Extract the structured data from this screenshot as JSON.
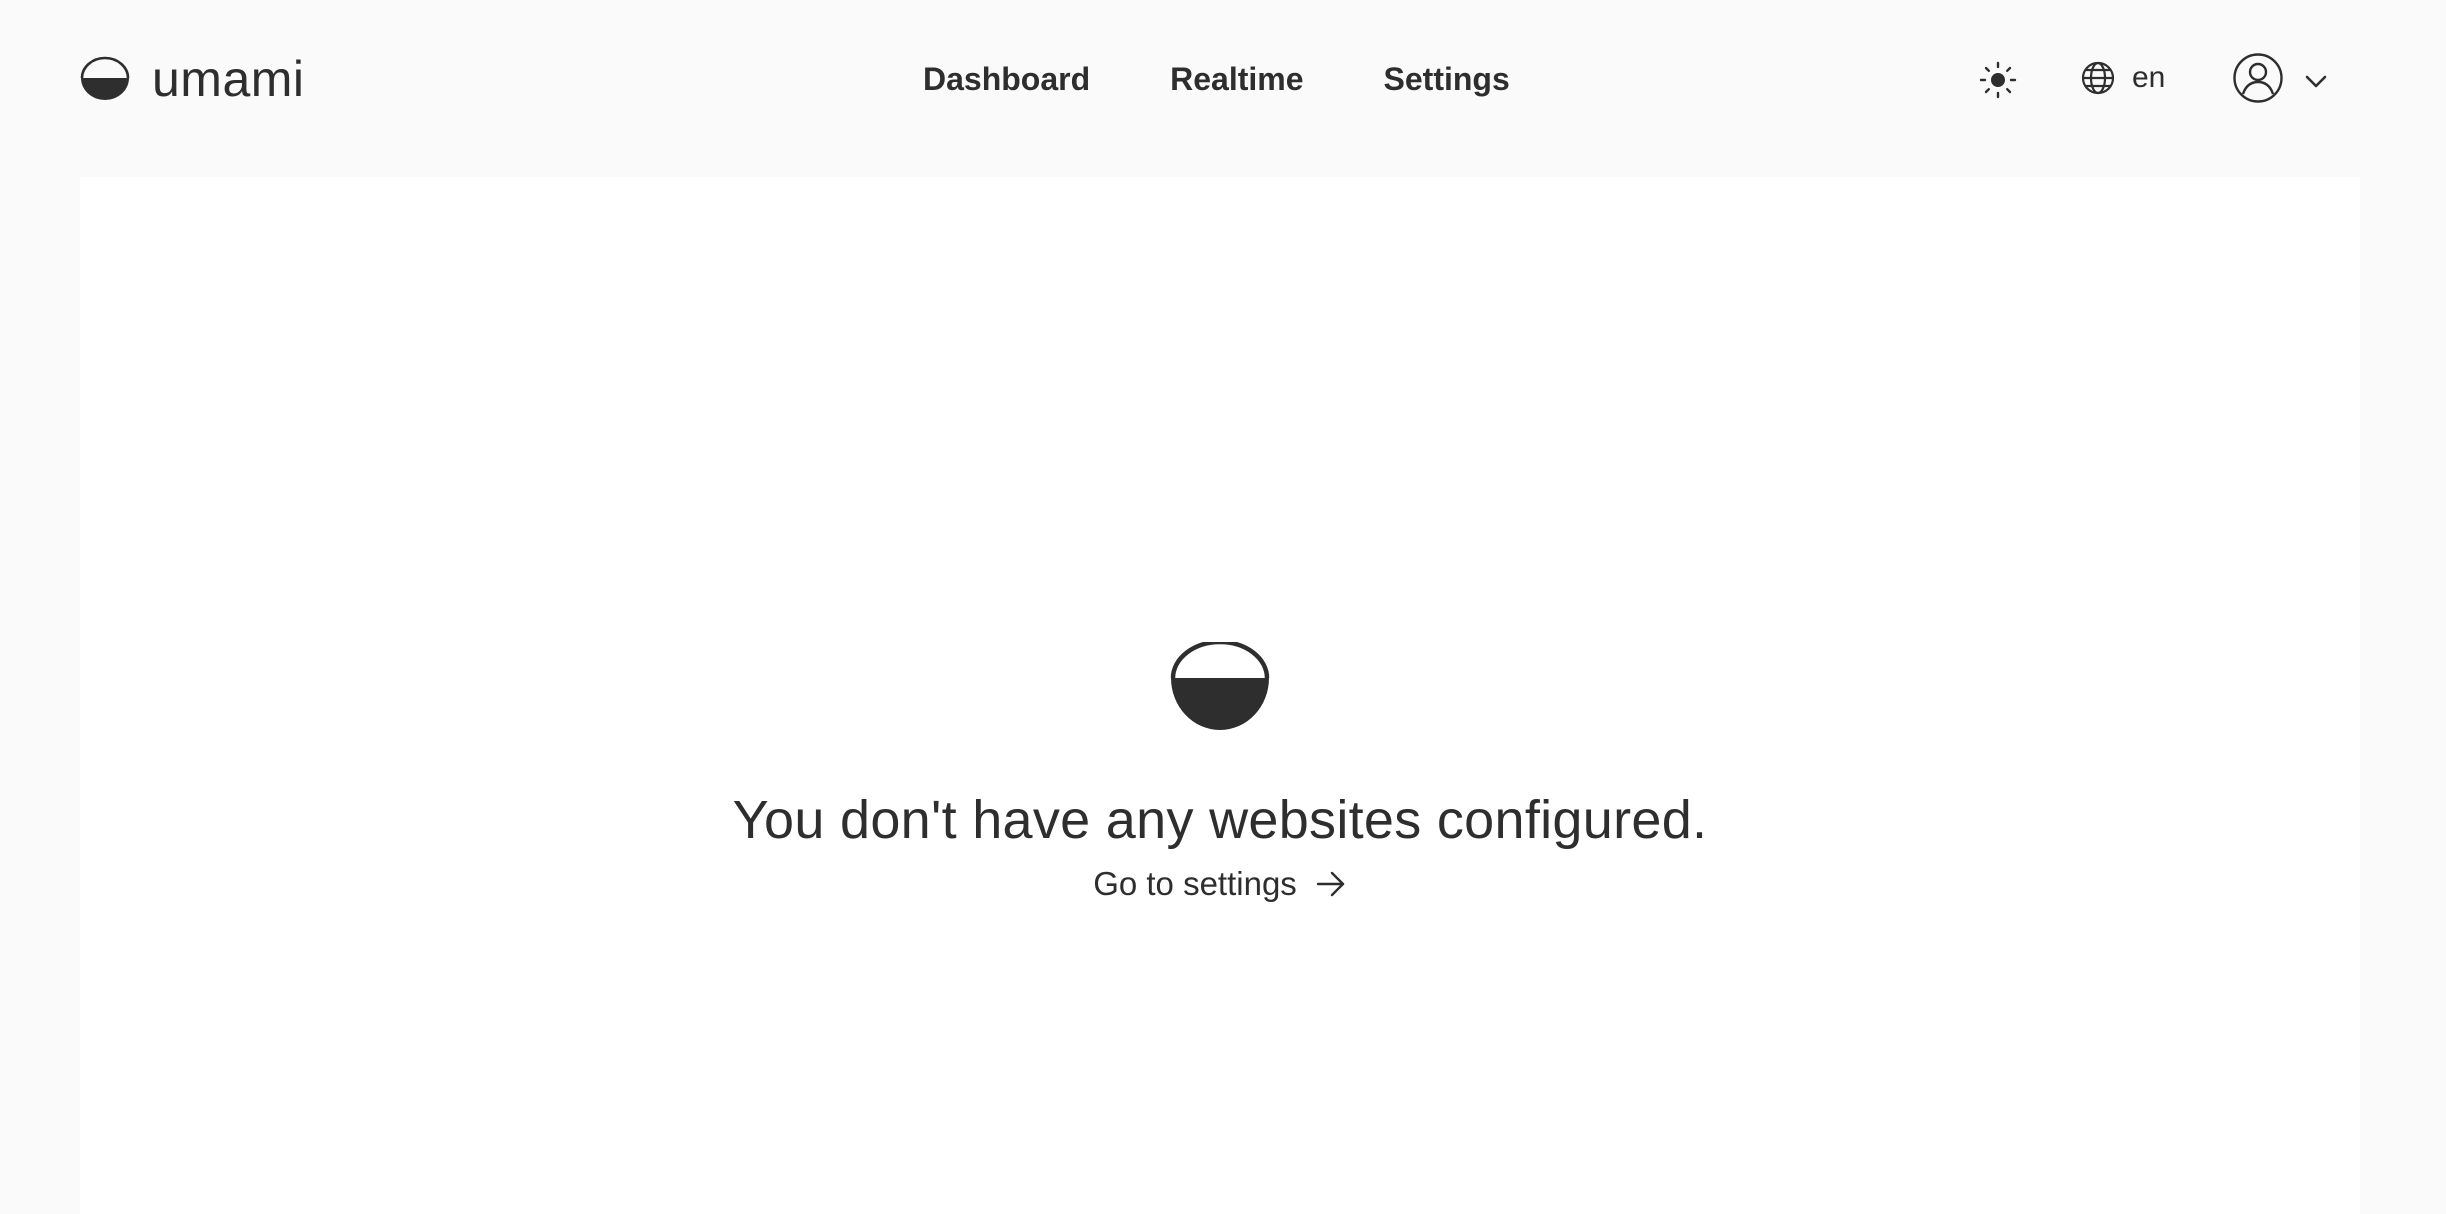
{
  "brand": {
    "name": "umami",
    "icon": "umami-logo-icon"
  },
  "nav": {
    "items": [
      {
        "label": "Dashboard"
      },
      {
        "label": "Realtime"
      },
      {
        "label": "Settings"
      }
    ]
  },
  "header_actions": {
    "theme_icon": "sun-icon",
    "language": {
      "icon": "globe-icon",
      "value": "en"
    },
    "user_menu": {
      "icon": "user-icon",
      "dropdown_icon": "chevron-down-icon"
    }
  },
  "empty_state": {
    "icon": "umami-logo-icon",
    "message": "You don't have any websites configured.",
    "link_label": "Go to settings",
    "link_icon": "arrow-right-icon"
  },
  "colors": {
    "page_background": "#fafafa",
    "panel_background": "#ffffff",
    "text": "#2e2e2e"
  }
}
